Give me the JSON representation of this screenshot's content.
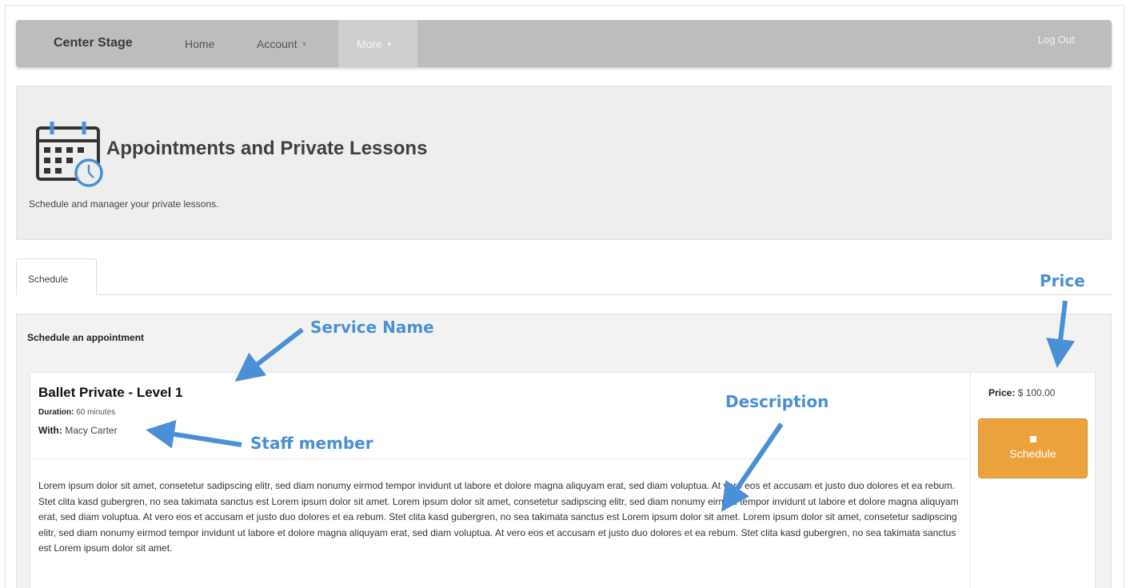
{
  "navbar": {
    "brand": "Center Stage",
    "home": "Home",
    "account": "Account",
    "more": "More",
    "logout": "Log Out"
  },
  "hero": {
    "icon": "calendar-clock-icon",
    "title": "Appointments and Private Lessons",
    "subtitle": "Schedule and manager your private lessons."
  },
  "tabs": [
    {
      "label": "Schedule"
    }
  ],
  "panel": {
    "heading": "Schedule an appointment",
    "service": {
      "name": "Ballet Private - Level 1",
      "duration_label": "Duration:",
      "duration_value": "60 minutes",
      "with_label": "With:",
      "with_value": "Macy Carter",
      "description": "Lorem ipsum dolor sit amet, consetetur sadipscing elitr, sed diam nonumy eirmod tempor invidunt ut labore et dolore magna aliquyam erat, sed diam voluptua. At vero eos et accusam et justo duo dolores et ea rebum. Stet clita kasd gubergren, no sea takimata sanctus est Lorem ipsum dolor sit amet. Lorem ipsum dolor sit amet, consetetur sadipscing elitr, sed diam nonumy eirmod tempor invidunt ut labore et dolore magna aliquyam erat, sed diam voluptua. At vero eos et accusam et justo duo dolores et ea rebum. Stet clita kasd gubergren, no sea takimata sanctus est Lorem ipsum dolor sit amet. Lorem ipsum dolor sit amet, consetetur sadipscing elitr, sed diam nonumy eirmod tempor invidunt ut labore et dolore magna aliquyam erat, sed diam voluptua. At vero eos et accusam et justo duo dolores et ea rebum. Stet clita kasd gubergren, no sea takimata sanctus est Lorem ipsum dolor sit amet.",
      "price_label": "Price:",
      "price_value": "$ 100.00",
      "schedule_button": "Schedule"
    }
  },
  "annotations": {
    "price": "Price",
    "service_name": "Service Name",
    "description": "Description",
    "staff_member": "Staff member",
    "color": "#4a90d6"
  }
}
